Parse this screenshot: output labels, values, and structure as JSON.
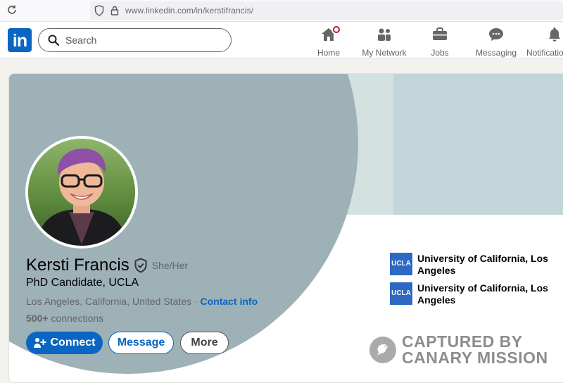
{
  "browser": {
    "url_host": "www.linkedin.com",
    "url_path": "/in/kerstifrancis/"
  },
  "nav": {
    "logo": "in",
    "search_placeholder": "Search",
    "items": [
      {
        "label": "Home",
        "icon": "home-icon"
      },
      {
        "label": "My Network",
        "icon": "network-icon"
      },
      {
        "label": "Jobs",
        "icon": "briefcase-icon"
      },
      {
        "label": "Messaging",
        "icon": "messaging-icon"
      },
      {
        "label": "Notifications",
        "icon": "bell-icon"
      }
    ]
  },
  "profile": {
    "name": "Kersti Francis",
    "pronouns": "She/Her",
    "headline": "PhD Candidate, UCLA",
    "location": "Los Angeles, California, United States",
    "separator": " · ",
    "contact_info": "Contact info",
    "connections_count": "500+",
    "connections_label": " connections",
    "buttons": {
      "connect": "Connect",
      "message": "Message",
      "more": "More"
    },
    "education": [
      {
        "logo_text": "UCLA",
        "name": "University of California, Los Angeles"
      },
      {
        "logo_text": "UCLA",
        "name": "University of California, Los Angeles"
      }
    ]
  },
  "watermark": {
    "line1": "CAPTURED BY",
    "line2": "CANARY MISSION"
  },
  "colors": {
    "brand": "#0a66c2",
    "badge": "#cb112d",
    "banner_light": "#c2d5d9",
    "banner_dark": "#9db1b6"
  }
}
